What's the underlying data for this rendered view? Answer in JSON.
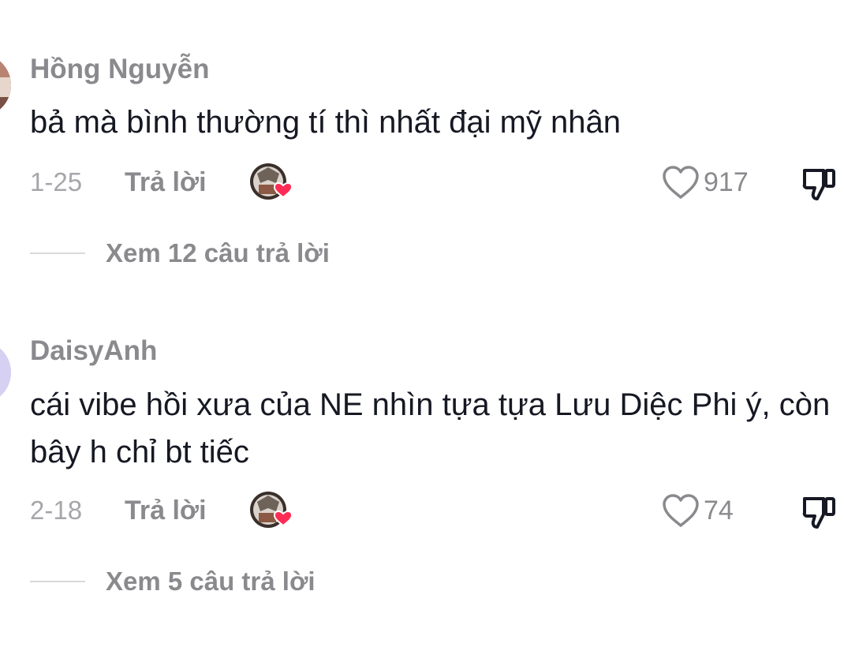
{
  "comments": [
    {
      "username": "Hồng Nguyễn",
      "text": "bả mà bình thường tí thì nhất đại mỹ nhân",
      "date": "1-25",
      "reply_label": "Trả lời",
      "likes": "917",
      "view_replies": "Xem 12 câu trả lời",
      "avatar_color": "#9b6b5c"
    },
    {
      "username": "DaisyAnh",
      "text": "cái vibe hồi xưa của NE nhìn tựa tựa Lưu Diệc Phi ý, còn bây h chỉ bt tiếc",
      "date": "2-18",
      "reply_label": "Trả lời",
      "likes": "74",
      "view_replies": "Xem 5 câu trả lời",
      "avatar_color": "#cfc8ef"
    }
  ],
  "icons": {
    "like": "heart-outline-icon",
    "dislike": "thumbs-down-icon",
    "creator_liked": "creator-heart-badge-icon",
    "heart_color": "#fe2c55"
  }
}
